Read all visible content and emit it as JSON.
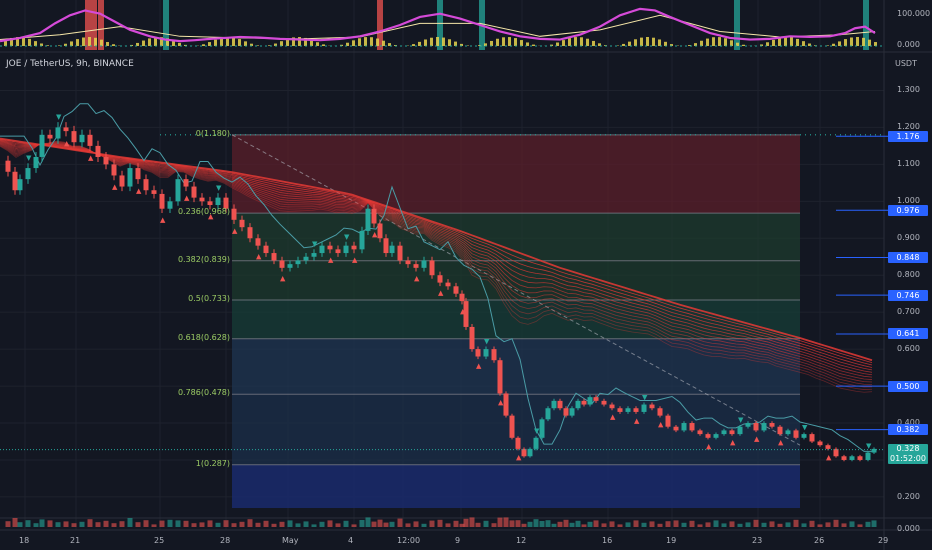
{
  "header": {
    "symbol": "JOE / TetherUS, 9h, BINANCE"
  },
  "price_unit": "USDT",
  "oscillator_axis": [
    "100.000",
    "0.000"
  ],
  "volume_axis": [
    "0.000"
  ],
  "colors": {
    "background": "#131722",
    "up": "#26a69a",
    "down": "#ef5350",
    "ribbon": "#e53935",
    "fib_line": "#787b86",
    "tag_blue": "#2962ff",
    "current_tag": "#26a69a"
  },
  "chart_data": {
    "type": "candlestick",
    "title": "",
    "y_axis": {
      "scale": "linear",
      "range": [
        0.17,
        1.35
      ],
      "ticks": [
        "1.300",
        "1.200",
        "1.100",
        "1.000",
        "0.900",
        "0.800",
        "0.700",
        "0.600",
        "0.500",
        "0.400",
        "0.300",
        "0.200"
      ]
    },
    "x_axis": {
      "labels": [
        "18",
        "21",
        "25",
        "28",
        "May",
        "4",
        "12:00",
        "9",
        "12",
        "16",
        "19",
        "23",
        "26",
        "29"
      ]
    },
    "fibonacci": [
      {
        "label": "0(1.180)",
        "value": 1.18
      },
      {
        "label": "0.236(0.968)",
        "value": 0.968
      },
      {
        "label": "0.382(0.839)",
        "value": 0.839
      },
      {
        "label": "0.5(0.733)",
        "value": 0.733
      },
      {
        "label": "0.618(0.628)",
        "value": 0.628
      },
      {
        "label": "0.786(0.478)",
        "value": 0.478
      },
      {
        "label": "1(0.287)",
        "value": 0.287
      }
    ],
    "price_tags": [
      {
        "label": "1.176",
        "value": 1.176
      },
      {
        "label": "0.976",
        "value": 0.976
      },
      {
        "label": "0.848",
        "value": 0.848
      },
      {
        "label": "0.746",
        "value": 0.746
      },
      {
        "label": "0.641",
        "value": 0.641
      },
      {
        "label": "0.500",
        "value": 0.5
      },
      {
        "label": "0.382",
        "value": 0.382
      }
    ],
    "current_price": {
      "label": "0.328",
      "countdown": "01:52:00",
      "value": 0.328
    },
    "price_path": [
      [
        0,
        1.11
      ],
      [
        8,
        1.08
      ],
      [
        15,
        1.03
      ],
      [
        20,
        1.06
      ],
      [
        28,
        1.09
      ],
      [
        36,
        1.12
      ],
      [
        42,
        1.18
      ],
      [
        50,
        1.17
      ],
      [
        58,
        1.2
      ],
      [
        66,
        1.19
      ],
      [
        74,
        1.16
      ],
      [
        82,
        1.18
      ],
      [
        90,
        1.15
      ],
      [
        98,
        1.12
      ],
      [
        106,
        1.1
      ],
      [
        114,
        1.07
      ],
      [
        122,
        1.04
      ],
      [
        130,
        1.09
      ],
      [
        138,
        1.06
      ],
      [
        146,
        1.03
      ],
      [
        154,
        1.02
      ],
      [
        162,
        0.98
      ],
      [
        170,
        1.0
      ],
      [
        178,
        1.06
      ],
      [
        186,
        1.04
      ],
      [
        194,
        1.01
      ],
      [
        202,
        1.0
      ],
      [
        210,
        0.99
      ],
      [
        218,
        1.01
      ],
      [
        226,
        0.98
      ],
      [
        234,
        0.95
      ],
      [
        242,
        0.93
      ],
      [
        250,
        0.9
      ],
      [
        258,
        0.88
      ],
      [
        266,
        0.86
      ],
      [
        274,
        0.84
      ],
      [
        282,
        0.82
      ],
      [
        290,
        0.83
      ],
      [
        298,
        0.84
      ],
      [
        306,
        0.85
      ],
      [
        314,
        0.86
      ],
      [
        322,
        0.88
      ],
      [
        330,
        0.87
      ],
      [
        338,
        0.86
      ],
      [
        346,
        0.88
      ],
      [
        354,
        0.87
      ],
      [
        362,
        0.92
      ],
      [
        368,
        0.98
      ],
      [
        374,
        0.94
      ],
      [
        380,
        0.9
      ],
      [
        386,
        0.86
      ],
      [
        392,
        0.88
      ],
      [
        400,
        0.84
      ],
      [
        408,
        0.83
      ],
      [
        416,
        0.82
      ],
      [
        424,
        0.84
      ],
      [
        432,
        0.8
      ],
      [
        440,
        0.78
      ],
      [
        448,
        0.77
      ],
      [
        456,
        0.75
      ],
      [
        462,
        0.73
      ],
      [
        466,
        0.66
      ],
      [
        472,
        0.6
      ],
      [
        478,
        0.58
      ],
      [
        486,
        0.6
      ],
      [
        494,
        0.57
      ],
      [
        500,
        0.48
      ],
      [
        506,
        0.42
      ],
      [
        512,
        0.36
      ],
      [
        518,
        0.33
      ],
      [
        524,
        0.31
      ],
      [
        530,
        0.33
      ],
      [
        536,
        0.36
      ],
      [
        542,
        0.41
      ],
      [
        548,
        0.44
      ],
      [
        554,
        0.46
      ],
      [
        560,
        0.44
      ],
      [
        566,
        0.42
      ],
      [
        572,
        0.44
      ],
      [
        578,
        0.46
      ],
      [
        584,
        0.45
      ],
      [
        590,
        0.47
      ],
      [
        596,
        0.46
      ],
      [
        604,
        0.45
      ],
      [
        612,
        0.44
      ],
      [
        620,
        0.43
      ],
      [
        628,
        0.44
      ],
      [
        636,
        0.43
      ],
      [
        644,
        0.45
      ],
      [
        652,
        0.44
      ],
      [
        660,
        0.42
      ],
      [
        668,
        0.39
      ],
      [
        676,
        0.38
      ],
      [
        684,
        0.4
      ],
      [
        692,
        0.38
      ],
      [
        700,
        0.37
      ],
      [
        708,
        0.36
      ],
      [
        716,
        0.37
      ],
      [
        724,
        0.38
      ],
      [
        732,
        0.37
      ],
      [
        740,
        0.39
      ],
      [
        748,
        0.4
      ],
      [
        756,
        0.38
      ],
      [
        764,
        0.4
      ],
      [
        772,
        0.39
      ],
      [
        780,
        0.37
      ],
      [
        788,
        0.38
      ],
      [
        796,
        0.36
      ],
      [
        804,
        0.37
      ],
      [
        812,
        0.35
      ],
      [
        820,
        0.34
      ],
      [
        828,
        0.33
      ],
      [
        836,
        0.31
      ],
      [
        844,
        0.3
      ],
      [
        852,
        0.31
      ],
      [
        860,
        0.3
      ],
      [
        868,
        0.32
      ],
      [
        874,
        0.33
      ]
    ],
    "series": [
      {
        "name": "",
        "type": "ribbon",
        "values": [
          [
            0,
            1.17
          ],
          [
            120,
            1.12
          ],
          [
            230,
            1.08
          ],
          [
            350,
            1.02
          ],
          [
            460,
            0.92
          ],
          [
            560,
            0.82
          ],
          [
            680,
            0.72
          ],
          [
            800,
            0.63
          ],
          [
            872,
            0.57
          ]
        ]
      }
    ],
    "oscillator": {
      "range": [
        0,
        130
      ],
      "line": [
        [
          0,
          15
        ],
        [
          20,
          25
        ],
        [
          40,
          40
        ],
        [
          55,
          70
        ],
        [
          70,
          95
        ],
        [
          85,
          110
        ],
        [
          100,
          100
        ],
        [
          115,
          75
        ],
        [
          130,
          50
        ],
        [
          150,
          30
        ],
        [
          165,
          20
        ],
        [
          180,
          15
        ],
        [
          195,
          18
        ],
        [
          210,
          22
        ],
        [
          225,
          25
        ],
        [
          240,
          28
        ],
        [
          260,
          26
        ],
        [
          280,
          22
        ],
        [
          300,
          20
        ],
        [
          320,
          18
        ],
        [
          340,
          22
        ],
        [
          360,
          30
        ],
        [
          380,
          45
        ],
        [
          400,
          65
        ],
        [
          420,
          90
        ],
        [
          440,
          100
        ],
        [
          460,
          85
        ],
        [
          480,
          65
        ],
        [
          500,
          45
        ],
        [
          520,
          30
        ],
        [
          540,
          22
        ],
        [
          560,
          20
        ],
        [
          580,
          35
        ],
        [
          600,
          60
        ],
        [
          620,
          95
        ],
        [
          640,
          115
        ],
        [
          655,
          110
        ],
        [
          670,
          90
        ],
        [
          690,
          65
        ],
        [
          710,
          40
        ],
        [
          730,
          25
        ],
        [
          750,
          20
        ],
        [
          770,
          22
        ],
        [
          790,
          30
        ],
        [
          810,
          28
        ],
        [
          830,
          30
        ],
        [
          845,
          40
        ],
        [
          855,
          55
        ],
        [
          865,
          60
        ],
        [
          875,
          40
        ]
      ],
      "signal": [
        [
          0,
          20
        ],
        [
          60,
          35
        ],
        [
          120,
          60
        ],
        [
          180,
          30
        ],
        [
          240,
          25
        ],
        [
          300,
          22
        ],
        [
          360,
          28
        ],
        [
          420,
          70
        ],
        [
          480,
          70
        ],
        [
          540,
          30
        ],
        [
          600,
          50
        ],
        [
          660,
          95
        ],
        [
          720,
          45
        ],
        [
          780,
          28
        ],
        [
          840,
          35
        ],
        [
          875,
          45
        ]
      ],
      "highlight_bars": [
        {
          "x": 88,
          "color": "#ef5350"
        },
        {
          "x": 94,
          "color": "#ef5350"
        },
        {
          "x": 101,
          "color": "#ef5350"
        },
        {
          "x": 166,
          "color": "#26a69a"
        },
        {
          "x": 380,
          "color": "#ef5350"
        },
        {
          "x": 440,
          "color": "#26a69a"
        },
        {
          "x": 482,
          "color": "#26a69a"
        },
        {
          "x": 737,
          "color": "#26a69a"
        },
        {
          "x": 866,
          "color": "#26a69a"
        }
      ]
    }
  }
}
